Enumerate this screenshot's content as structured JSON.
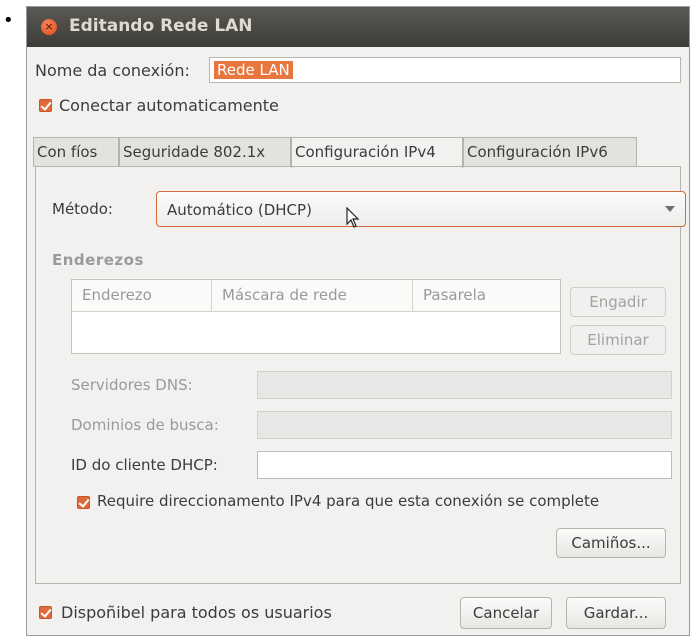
{
  "window": {
    "title": "Editando Rede LAN"
  },
  "name": {
    "label": "Nome da conexión:",
    "value": "Rede LAN"
  },
  "autoconnect": {
    "label": "Conectar automaticamente",
    "checked": true
  },
  "tabs": [
    {
      "label": "Con fíos",
      "active": false
    },
    {
      "label": "Seguridade 802.1x",
      "active": false
    },
    {
      "label": "Configuración IPv4",
      "active": true
    },
    {
      "label": "Configuración IPv6",
      "active": false
    }
  ],
  "ipv4": {
    "method_label": "Método:",
    "method_value": "Automático (DHCP)",
    "addresses_heading": "Enderezos",
    "columns": [
      "Enderezo",
      "Máscara de rede",
      "Pasarela"
    ],
    "add_label": "Engadir",
    "delete_label": "Eliminar",
    "dns_label": "Servidores DNS:",
    "search_label": "Dominios de busca:",
    "dhcp_id_label": "ID do cliente DHCP:",
    "require_label": "Require direccionamento IPv4 para que esta conexión se complete",
    "require_checked": true,
    "routes_label": "Camiños..."
  },
  "footer": {
    "all_users_label": "Dispoñibel para todos os usuarios",
    "all_users_checked": true,
    "cancel_label": "Cancelar",
    "save_label": "Gardar..."
  }
}
